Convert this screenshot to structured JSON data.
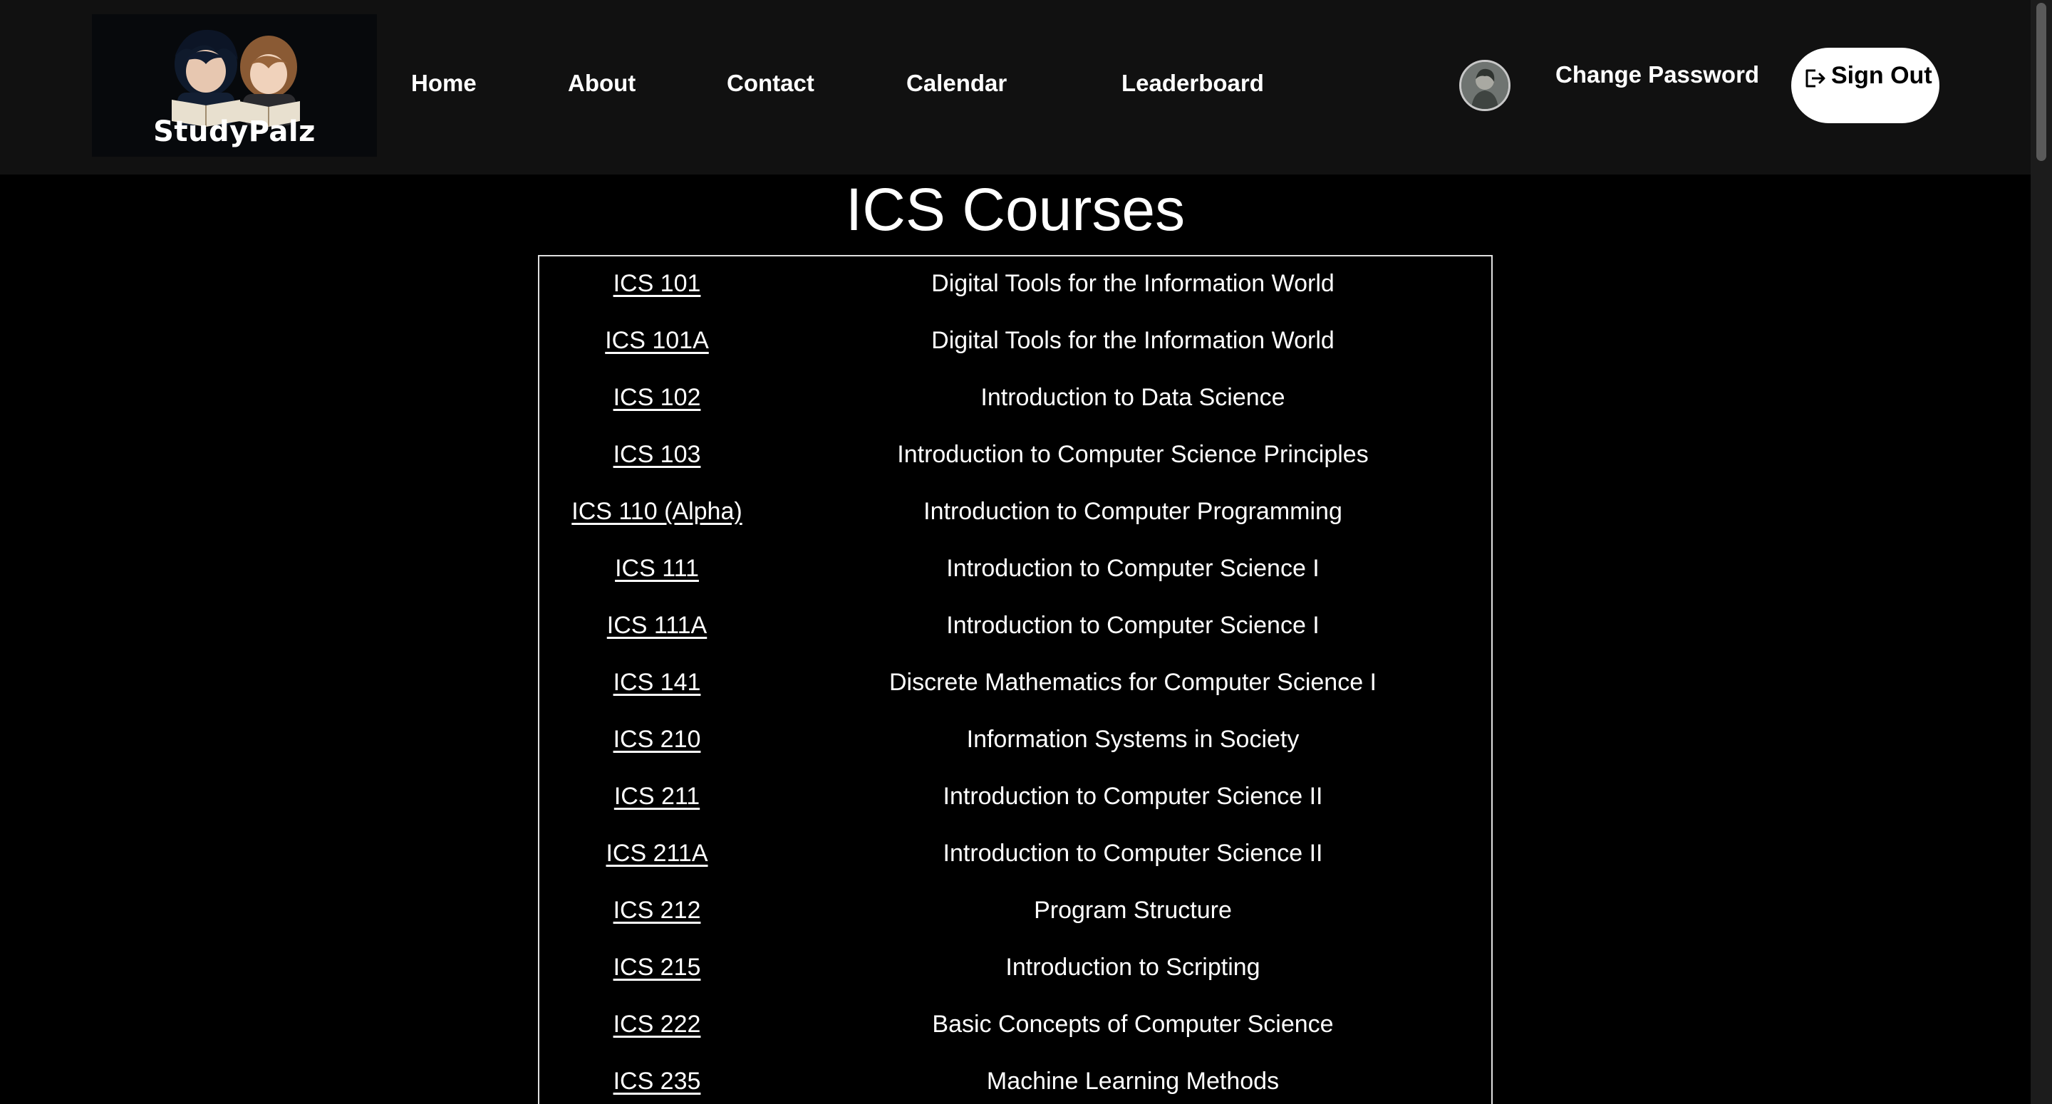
{
  "nav": {
    "logo_text": "StudyPalz",
    "links": [
      "Home",
      "About",
      "Contact",
      "Calendar",
      "Leaderboard"
    ],
    "change_password": "Change Password",
    "sign_out": "Sign Out"
  },
  "main": {
    "title": "ICS Courses",
    "courses": [
      {
        "code": "ICS 101",
        "name": "Digital Tools for the Information World"
      },
      {
        "code": "ICS 101A",
        "name": "Digital Tools for the Information World"
      },
      {
        "code": "ICS 102",
        "name": "Introduction to Data Science"
      },
      {
        "code": "ICS 103",
        "name": "Introduction to Computer Science Principles"
      },
      {
        "code": "ICS 110 (Alpha)",
        "name": "Introduction to Computer Programming"
      },
      {
        "code": "ICS 111",
        "name": "Introduction to Computer Science I"
      },
      {
        "code": "ICS 111A",
        "name": "Introduction to Computer Science I"
      },
      {
        "code": "ICS 141",
        "name": "Discrete Mathematics for Computer Science I"
      },
      {
        "code": "ICS 210",
        "name": "Information Systems in Society"
      },
      {
        "code": "ICS 211",
        "name": "Introduction to Computer Science II"
      },
      {
        "code": "ICS 211A",
        "name": "Introduction to Computer Science II"
      },
      {
        "code": "ICS 212",
        "name": "Program Structure"
      },
      {
        "code": "ICS 215",
        "name": "Introduction to Scripting"
      },
      {
        "code": "ICS 222",
        "name": "Basic Concepts of Computer Science"
      },
      {
        "code": "ICS 235",
        "name": "Machine Learning Methods"
      }
    ]
  },
  "colors": {
    "page_bg": "#000000",
    "navbar_bg": "#111111",
    "text": "#ffffff",
    "signout_bg": "#ffffff",
    "signout_text": "#000000"
  },
  "icons": [
    "sign-out-icon",
    "avatar"
  ]
}
